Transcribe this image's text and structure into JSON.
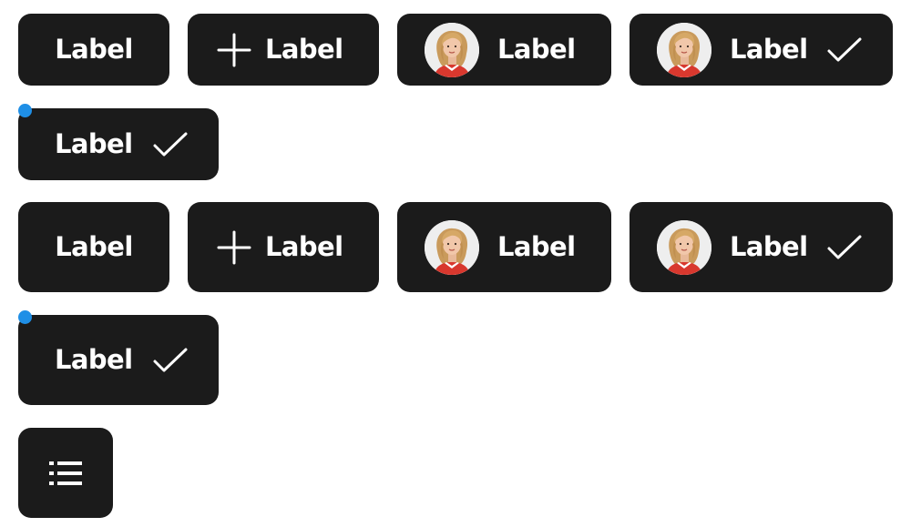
{
  "colors": {
    "chip_background": "#1b1b1b",
    "chip_text": "#ffffff",
    "indicator_dot": "#1f8fe6",
    "page_background": "#ffffff"
  },
  "group_1": {
    "plain_chip": {
      "label": "Label"
    },
    "add_chip": {
      "label": "Label",
      "icon": "plus-icon"
    },
    "avatar_chip": {
      "label": "Label",
      "icon": "avatar"
    },
    "avatar_selected_chip": {
      "label": "Label",
      "icon": "checkmark-icon"
    },
    "selected_chip_with_dot": {
      "label": "Label",
      "icon": "checkmark-icon",
      "indicator": "notification-dot"
    }
  },
  "group_2": {
    "plain_chip": {
      "label": "Label"
    },
    "add_chip": {
      "label": "Label",
      "icon": "plus-icon"
    },
    "avatar_chip": {
      "label": "Label",
      "icon": "avatar"
    },
    "avatar_selected_chip": {
      "label": "Label",
      "icon": "checkmark-icon"
    },
    "selected_chip_with_dot": {
      "label": "Label",
      "icon": "checkmark-icon",
      "indicator": "notification-dot"
    }
  },
  "icon_only_chip": {
    "icon": "list-icon"
  }
}
